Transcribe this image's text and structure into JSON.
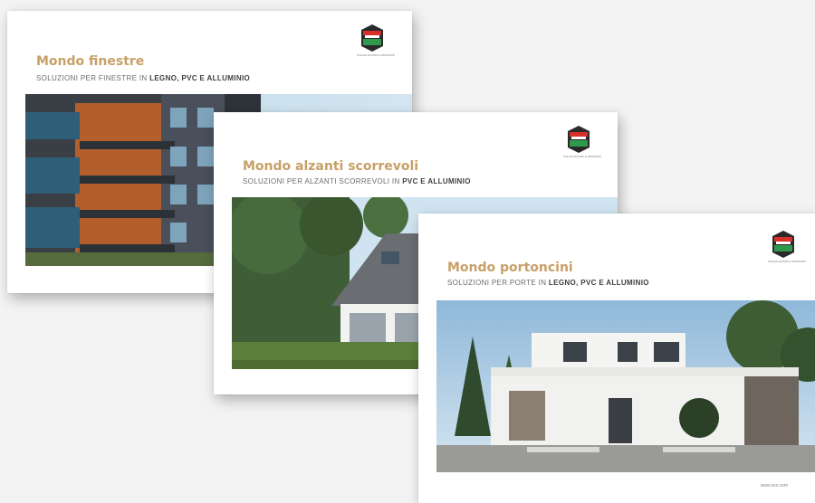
{
  "brochures": [
    {
      "title": "Mondo finestre",
      "subtitle_prefix": "SOLUZIONI PER FINESTRE IN ",
      "subtitle_bold": "LEGNO, PVC E ALLUMINIO",
      "logo_caption": "ITALIAN DOORS & WINDOWS"
    },
    {
      "title": "Mondo alzanti scorrevoli",
      "subtitle_prefix": "SOLUZIONI PER ALZANTI SCORREVOLI IN ",
      "subtitle_bold": "PVC E ALLUMINIO",
      "logo_caption": "ITALIAN DOORS & WINDOWS"
    },
    {
      "title": "Mondo portoncini",
      "subtitle_prefix": "SOLUZIONI PER PORTE IN ",
      "subtitle_bold": "LEGNO, PVC E ALLUMINIO",
      "logo_caption": "ITALIAN DOORS & WINDOWS",
      "footer_url": "www.xxx.com"
    }
  ],
  "colors": {
    "title": "#c7a067",
    "logo_green": "#2f9a4b",
    "logo_red": "#d7302a",
    "logo_dark": "#2a2a2a"
  },
  "icons": [
    "brand-logo-icon"
  ]
}
